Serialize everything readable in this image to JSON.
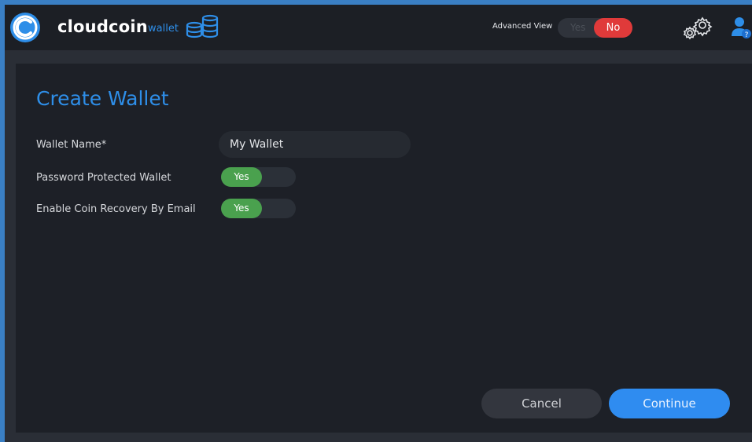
{
  "header": {
    "brand": "cloudcoin",
    "brand_sub": "wallet",
    "advanced_view": {
      "label": "Advanced View",
      "off_label": "Yes",
      "on_label": "No",
      "selected": "No"
    },
    "icons": [
      "cloudcoin-logo-icon",
      "coins-stack-icon",
      "settings-gears-icon",
      "user-help-icon"
    ]
  },
  "form": {
    "title": "Create Wallet",
    "wallet_name": {
      "label": "Wallet Name*",
      "value": "My Wallet"
    },
    "password_protected": {
      "label": "Password Protected Wallet",
      "value": "Yes"
    },
    "coin_recovery": {
      "label": "Enable Coin Recovery By Email",
      "value": "Yes"
    }
  },
  "actions": {
    "cancel": "Cancel",
    "continue": "Continue"
  },
  "colors": {
    "accent": "#2e8ee8",
    "toggle_on": "#4aa14e",
    "toggle_no": "#e03a3a"
  }
}
